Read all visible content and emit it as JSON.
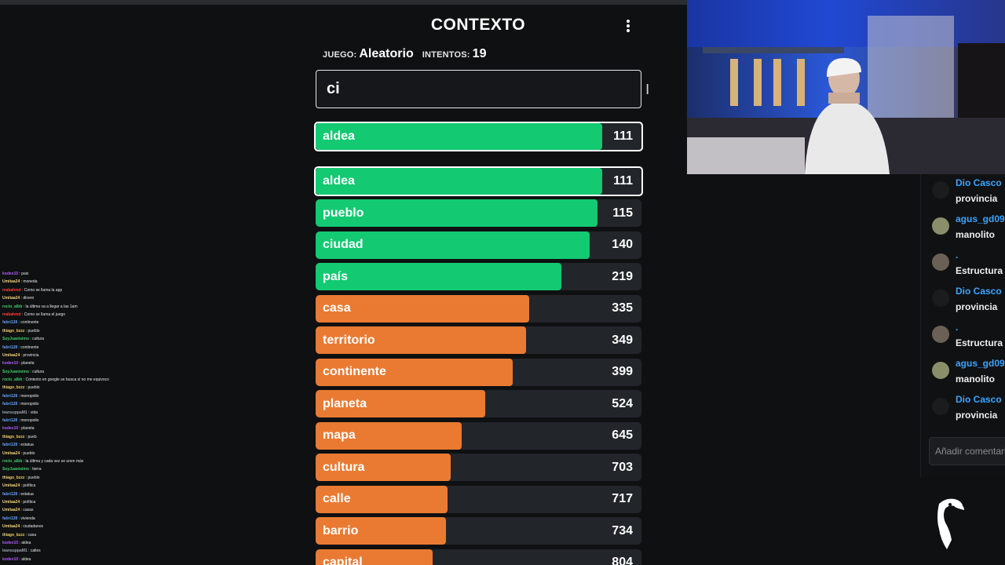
{
  "game": {
    "title": "CONTEXTO",
    "game_label": "JUEGO:",
    "game_value": "Aleatorio",
    "attempts_label": "INTENTOS:",
    "attempts_value": "19",
    "input_value": "ci",
    "last_guess": {
      "word": "aldea",
      "rank": "111"
    },
    "guesses": [
      {
        "word": "aldea",
        "rank": "111",
        "level": 0.88,
        "color": "#13c972",
        "highlight": true
      },
      {
        "word": "pueblo",
        "rank": "115",
        "level": 0.865,
        "color": "#13c972",
        "highlight": false
      },
      {
        "word": "ciudad",
        "rank": "140",
        "level": 0.84,
        "color": "#13c972",
        "highlight": false
      },
      {
        "word": "país",
        "rank": "219",
        "level": 0.755,
        "color": "#13c972",
        "highlight": false
      },
      {
        "word": "casa",
        "rank": "335",
        "level": 0.655,
        "color": "#ea7a32",
        "highlight": false
      },
      {
        "word": "territorio",
        "rank": "349",
        "level": 0.645,
        "color": "#ea7a32",
        "highlight": false
      },
      {
        "word": "continente",
        "rank": "399",
        "level": 0.605,
        "color": "#ea7a32",
        "highlight": false
      },
      {
        "word": "planeta",
        "rank": "524",
        "level": 0.52,
        "color": "#ea7a32",
        "highlight": false
      },
      {
        "word": "mapa",
        "rank": "645",
        "level": 0.447,
        "color": "#ea7a32",
        "highlight": false
      },
      {
        "word": "cultura",
        "rank": "703",
        "level": 0.415,
        "color": "#ea7a32",
        "highlight": false
      },
      {
        "word": "calle",
        "rank": "717",
        "level": 0.406,
        "color": "#ea7a32",
        "highlight": false
      },
      {
        "word": "barrio",
        "rank": "734",
        "level": 0.4,
        "color": "#ea7a32",
        "highlight": false
      },
      {
        "word": "capital",
        "rank": "804",
        "level": 0.36,
        "color": "#ea7a32",
        "highlight": false
      }
    ]
  },
  "chat": {
    "messages": [
      {
        "user": "Dio Casco",
        "text": "provincia",
        "avatar": "#1c1c1c"
      },
      {
        "user": "agus_gd09",
        "text": "manolito",
        "avatar": "#8a8f6a"
      },
      {
        "user": ".",
        "text": "Estructura",
        "avatar": "#6b6055"
      },
      {
        "user": "Dio Casco",
        "text": "provincia",
        "avatar": "#1c1c1c"
      },
      {
        "user": ".",
        "text": "Estructura",
        "avatar": "#6b6055"
      },
      {
        "user": "agus_gd09",
        "text": "manolito",
        "avatar": "#8a8f6a"
      },
      {
        "user": "Dio Casco",
        "text": "provincia",
        "avatar": "#1c1c1c"
      }
    ],
    "input_placeholder": "Añadir comentario"
  },
  "overlay_chat": [
    {
      "user": "kodex10",
      "text": "pais",
      "color": "#b05cff"
    },
    {
      "user": "Umitaa24",
      "text": "moneda",
      "color": "#f0d070"
    },
    {
      "user": "mabahmd",
      "text": "Como se llama la app",
      "color": "#ff3b3b"
    },
    {
      "user": "Umitaa24",
      "text": "dinero",
      "color": "#f0d070"
    },
    {
      "user": "rocio_albb",
      "text": "la última va a llegar a las 1am",
      "color": "#3cd06a"
    },
    {
      "user": "mabahmd",
      "text": "Como se llama el juego",
      "color": "#ff3b3b"
    },
    {
      "user": "fabri128",
      "text": "continente",
      "color": "#5aa0ff"
    },
    {
      "user": "thiago_bzzz",
      "text": "pueblo",
      "color": "#f0d070"
    },
    {
      "user": "SoyJuanisimo",
      "text": "cultura",
      "color": "#3cd06a"
    },
    {
      "user": "fabri128",
      "text": "continente",
      "color": "#5aa0ff"
    },
    {
      "user": "Umitaa24",
      "text": "provincia",
      "color": "#f0d070"
    },
    {
      "user": "kodex10",
      "text": "planeta",
      "color": "#b05cff"
    },
    {
      "user": "SoyJuanisimo",
      "text": "cultura",
      "color": "#3cd06a"
    },
    {
      "user": "rocio_albb",
      "text": "Contexto en google se busca si no me equivoco",
      "color": "#3cd06a"
    },
    {
      "user": "thiago_bzzz",
      "text": "pueblo",
      "color": "#f0d070"
    },
    {
      "user": "fabri128",
      "text": "monopolio",
      "color": "#5aa0ff"
    },
    {
      "user": "fabri128",
      "text": "monopolio",
      "color": "#5aa0ff"
    },
    {
      "user": "leansuppaM1",
      "text": "vida",
      "color": "#9aa4b0"
    },
    {
      "user": "fabri128",
      "text": "monopolio",
      "color": "#5aa0ff"
    },
    {
      "user": "kodex10",
      "text": "planeta",
      "color": "#b05cff"
    },
    {
      "user": "thiago_bzzz",
      "text": "pueb",
      "color": "#f0d070"
    },
    {
      "user": "fabri128",
      "text": "estatua",
      "color": "#5aa0ff"
    },
    {
      "user": "Umitaa24",
      "text": "pueblo",
      "color": "#f0d070"
    },
    {
      "user": "rocio_albb",
      "text": "la última y cada vez se unen más",
      "color": "#3cd06a"
    },
    {
      "user": "SoyJuanisimo",
      "text": "tierra",
      "color": "#3cd06a"
    },
    {
      "user": "thiago_bzzz",
      "text": "pueblo",
      "color": "#f0d070"
    },
    {
      "user": "Umitaa24",
      "text": "política",
      "color": "#f0d070"
    },
    {
      "user": "fabri128",
      "text": "estatua",
      "color": "#5aa0ff"
    },
    {
      "user": "Umitaa24",
      "text": "política",
      "color": "#f0d070"
    },
    {
      "user": "Umitaa24",
      "text": "casas",
      "color": "#f0d070"
    },
    {
      "user": "fabri128",
      "text": "vivienda",
      "color": "#5aa0ff"
    },
    {
      "user": "Umitaa24",
      "text": "ciudadanos",
      "color": "#f0d070"
    },
    {
      "user": "thiago_bzzz",
      "text": "casa",
      "color": "#f0d070"
    },
    {
      "user": "kodex10",
      "text": "aldea",
      "color": "#b05cff"
    },
    {
      "user": "leansuppaM1",
      "text": "calles",
      "color": "#9aa4b0"
    },
    {
      "user": "kodex10",
      "text": "aldea",
      "color": "#b05cff"
    }
  ]
}
